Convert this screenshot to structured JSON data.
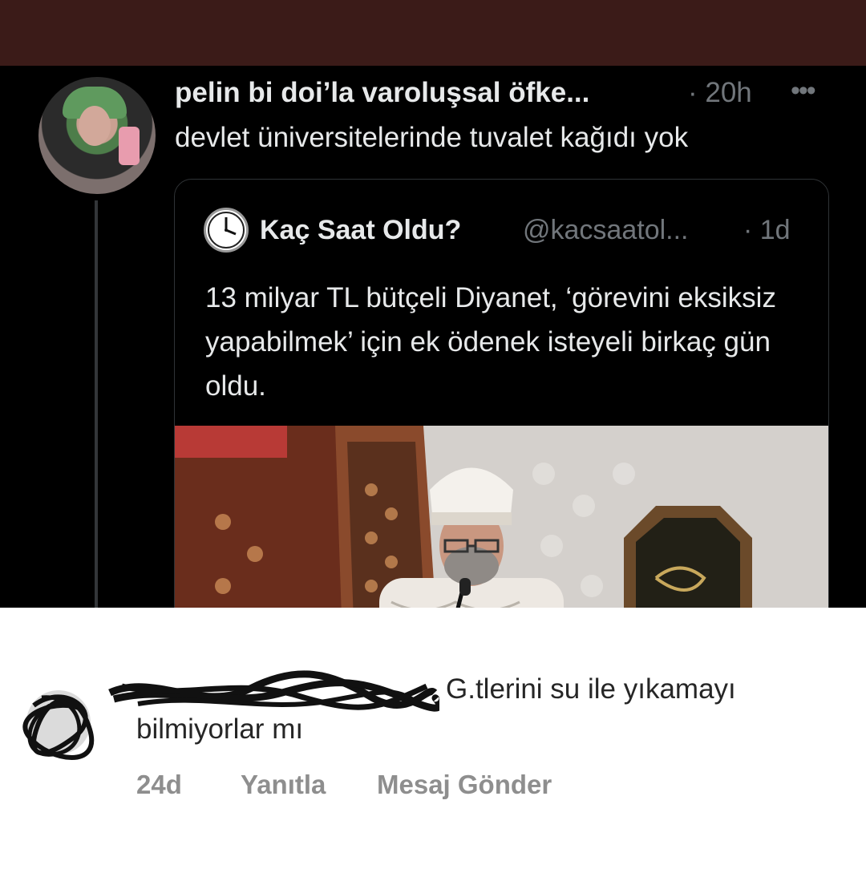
{
  "tweet": {
    "display_name": "pelin bi doi’la varoluşsal öfke...",
    "time": "· 20h",
    "more_icon": "more-horizontal-icon",
    "text": "devlet üniversitelerinde tuvalet kağıdı yok",
    "quoted": {
      "display_name": "Kaç Saat Oldu?",
      "handle": "@kacsaatol...",
      "time": "· 1d",
      "text": "13 milyar TL bütçeli Diyanet, ‘görevini eksiksiz yapabilmek’ için ek ödenek isteyeli birkaç gün oldu.",
      "avatar_icon": "clock-icon"
    }
  },
  "comment": {
    "text_line1": "G.tlerini su ile yıkamayı",
    "text_line2": "bilmiyorlar mı",
    "age": "24d",
    "reply_label": "Yanıtla",
    "message_label": "Mesaj Gönder"
  },
  "colors": {
    "top_bar": "#3b1b18",
    "tweet_bg": "#000000",
    "tweet_text": "#e7e9ea",
    "muted_text": "#71767b",
    "comment_text": "#262626",
    "comment_meta": "#8e8e8e"
  }
}
